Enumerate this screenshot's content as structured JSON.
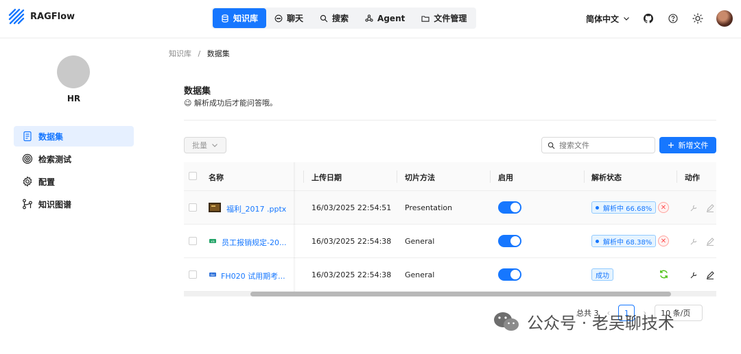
{
  "app": {
    "name": "RAGFlow"
  },
  "nav": {
    "items": [
      {
        "label": "知识库",
        "icon": "database-icon",
        "active": true
      },
      {
        "label": "聊天",
        "icon": "chat-icon"
      },
      {
        "label": "搜索",
        "icon": "search-icon"
      },
      {
        "label": "Agent",
        "icon": "agent-icon"
      },
      {
        "label": "文件管理",
        "icon": "folder-icon"
      }
    ]
  },
  "header": {
    "language": "简体中文"
  },
  "sidebar": {
    "kb_name": "HR",
    "items": [
      {
        "label": "数据集",
        "icon": "document-icon",
        "active": true
      },
      {
        "label": "检索测试",
        "icon": "target-icon"
      },
      {
        "label": "配置",
        "icon": "gear-icon"
      },
      {
        "label": "知识图谱",
        "icon": "graph-icon"
      }
    ]
  },
  "breadcrumb": {
    "root": "知识库",
    "sep": "/",
    "current": "数据集"
  },
  "page": {
    "title": "数据集",
    "subtitle": "😉 解析成功后才能问答哦。"
  },
  "toolbar": {
    "batch_label": "批量",
    "search_placeholder": "搜索文件",
    "add_label": "新增文件"
  },
  "table": {
    "columns": [
      "名称",
      "上传日期",
      "切片方法",
      "启用",
      "解析状态",
      "动作"
    ],
    "rows": [
      {
        "name": "福利_2017 .pptx",
        "date": "16/03/2025 22:54:51",
        "method": "Presentation",
        "enabled": true,
        "status": "解析中  66.68%",
        "state": "parsing"
      },
      {
        "name": "员工报销规定-20...",
        "date": "16/03/2025 22:54:38",
        "method": "General",
        "enabled": true,
        "status": "解析中  68.38%",
        "state": "parsing"
      },
      {
        "name": "FH020 试用期考...",
        "date": "16/03/2025 22:54:38",
        "method": "General",
        "enabled": true,
        "status": "成功",
        "state": "success"
      }
    ]
  },
  "pagination": {
    "total": "总共 3",
    "current_page": "1",
    "page_size": "10 条/页"
  },
  "watermark": {
    "text": "公众号 · 老吴聊技术"
  },
  "colors": {
    "accent": "#1677ff",
    "danger": "#ff4d4f",
    "success": "#52c41a"
  }
}
